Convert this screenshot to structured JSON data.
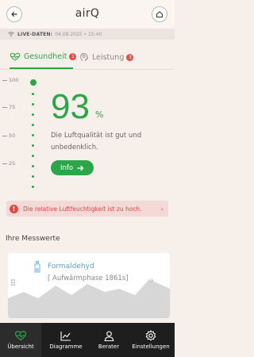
{
  "header": {
    "title": "airQ",
    "live_label": "LIVE-DATEN:",
    "live_datetime": "04.08.2025 • 15:40"
  },
  "tabs": [
    {
      "label": "Gesundheit",
      "badge": "1",
      "active": true
    },
    {
      "label": "Leistung",
      "badge": "3",
      "active": false
    }
  ],
  "gauge": {
    "scale_ticks": [
      "100",
      "75",
      "50",
      "25"
    ],
    "value": "93",
    "unit": "%",
    "level_fraction": 0.93,
    "status_text": "Die Luftqualität ist gut und unbedenklich.",
    "info_button": "Info"
  },
  "warning": {
    "text": "Die relative Luftfeuchtigkeit ist zu hoch."
  },
  "measurements": {
    "title": "Ihre Messwerte",
    "items": [
      {
        "name": "Formaldehyd",
        "status": "[ Aufwärmphase 1861s]"
      }
    ]
  },
  "bottom_nav": [
    {
      "label": "Übersicht",
      "icon": "heart-pulse-icon",
      "active": true
    },
    {
      "label": "Diagramme",
      "icon": "chart-line-icon",
      "active": false
    },
    {
      "label": "Berater",
      "icon": "person-icon",
      "active": false
    },
    {
      "label": "Einstellungen",
      "icon": "gear-icon",
      "active": false
    }
  ],
  "colors": {
    "accent_green": "#2aa748",
    "badge_red": "#e24b4b",
    "warning_bg": "#f3dad7",
    "nav_bg": "#1e1e1e"
  }
}
